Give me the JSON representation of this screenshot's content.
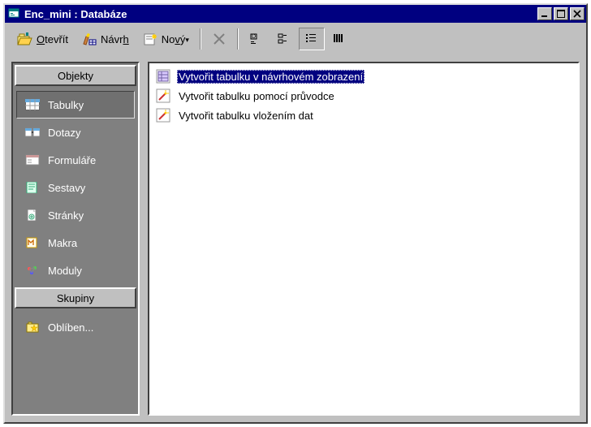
{
  "title": "Enc_mini : Databáze",
  "toolbar": {
    "open_label": "Otevřít",
    "open_key": "O",
    "design_label": "Návrh",
    "design_key": "h",
    "new_label": "Nový",
    "new_key": "v",
    "drop_char": "▾"
  },
  "sidebar": {
    "header_objects": "Objekty",
    "header_groups": "Skupiny",
    "items": [
      {
        "label": "Tabulky"
      },
      {
        "label": "Dotazy"
      },
      {
        "label": "Formuláře"
      },
      {
        "label": "Sestavy"
      },
      {
        "label": "Stránky"
      },
      {
        "label": "Makra"
      },
      {
        "label": "Moduly"
      }
    ],
    "groups": [
      {
        "label": "Oblíben..."
      }
    ]
  },
  "main": {
    "items": [
      {
        "label": "Vytvořit tabulku v návrhovém zobrazení"
      },
      {
        "label": "Vytvořit tabulku pomocí průvodce"
      },
      {
        "label": "Vytvořit tabulku vložením dat"
      }
    ]
  }
}
